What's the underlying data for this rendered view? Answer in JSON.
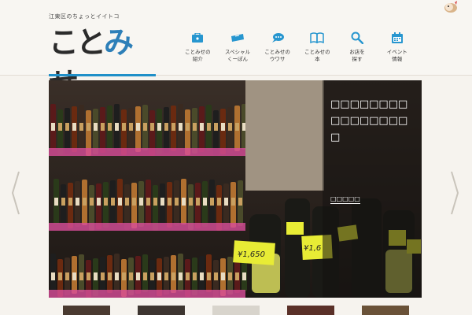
{
  "header": {
    "tagline": "江東区のちょっとイイトコ",
    "logo": {
      "part1": "こと",
      "part2": "み",
      "part3": "せ"
    }
  },
  "nav": {
    "items": [
      {
        "label": "ことみせの\n紹介",
        "icon": "shop-icon"
      },
      {
        "label": "スペシャル\nくーぽん",
        "icon": "ticket-icon"
      },
      {
        "label": "ことみせの\nウワサ",
        "icon": "chat-bubble-icon"
      },
      {
        "label": "ことみせの\n本",
        "icon": "book-icon"
      },
      {
        "label": "お店を\n探す",
        "icon": "search-icon"
      },
      {
        "label": "イベント\n情報",
        "icon": "calendar-icon"
      }
    ]
  },
  "slider": {
    "caption_title": "□□□□□□□□□□□□□□□□□",
    "caption_more": "□□□□□"
  },
  "colors": {
    "accent": "#1f8fc8",
    "price_tag": "#e8ec35",
    "shelf_label": "#d94d9a"
  }
}
